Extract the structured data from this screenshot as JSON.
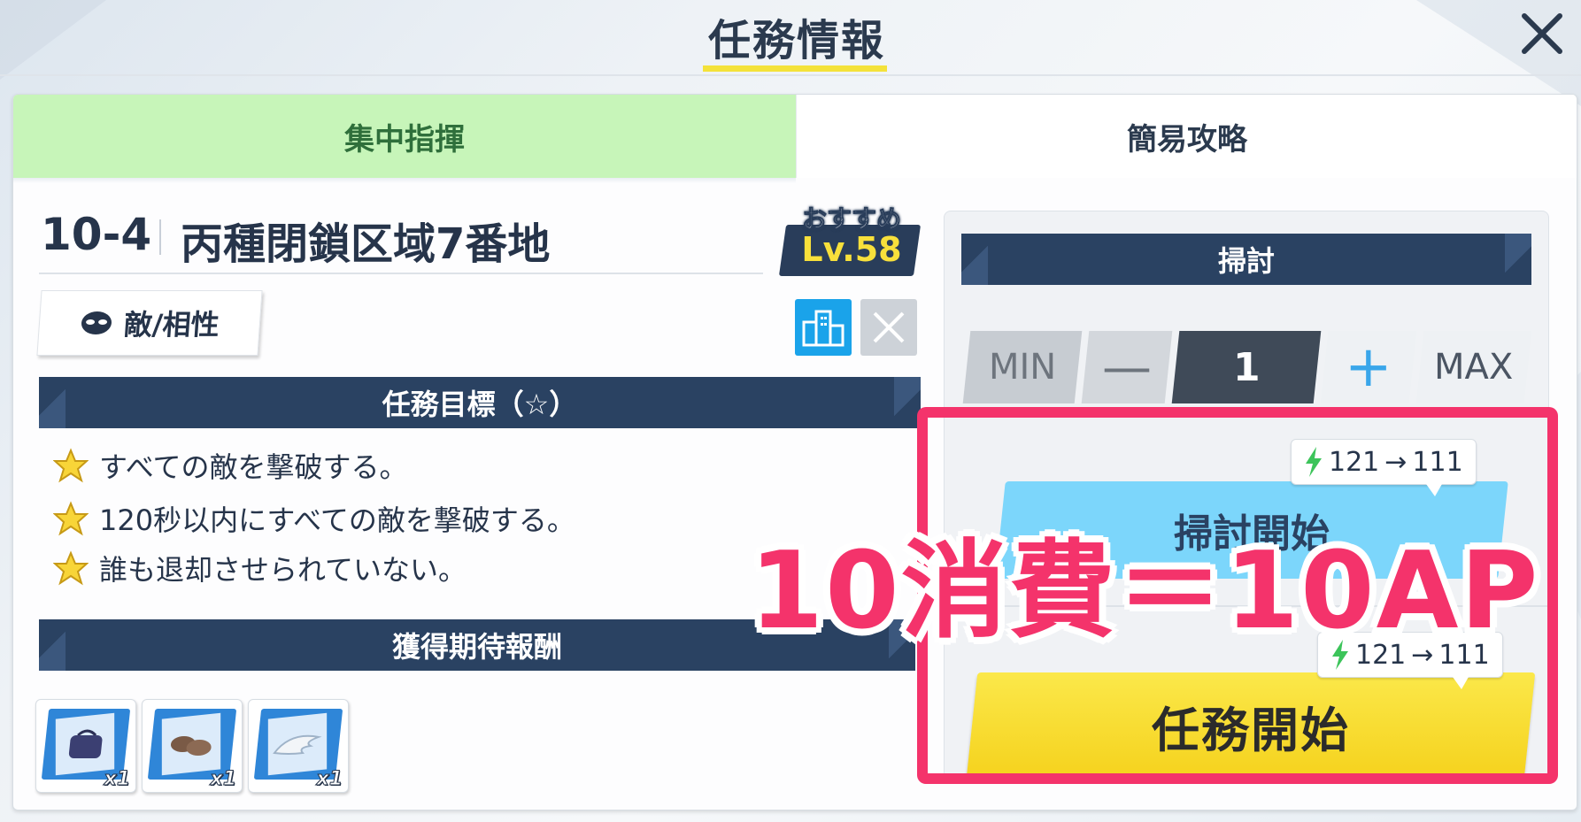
{
  "header": {
    "title": "任務情報",
    "close_icon": "close-icon"
  },
  "tabs": [
    {
      "label": "集中指揮",
      "selected": true
    },
    {
      "label": "簡易攻略",
      "selected": false
    }
  ],
  "stage": {
    "code": "10-4",
    "name": "丙種閉鎖区域7番地",
    "recommended_label": "おすすめ",
    "recommended_level": "Lv.58"
  },
  "enemy_button": {
    "label": "敵/相性",
    "icon": "enemy-mask-icon"
  },
  "terrain_icons": [
    "building-icon",
    "x-disabled-icon"
  ],
  "objectives": {
    "header": "任務目標（☆）",
    "items": [
      "すべての敵を撃破する。",
      "120秒以内にすべての敵を撃破する。",
      "誰も退却させられていない。"
    ]
  },
  "rewards": {
    "header": "獲得期待報酬",
    "items": [
      {
        "icon": "bag-icon",
        "qty": "x1"
      },
      {
        "icon": "shoes-icon",
        "qty": "x1"
      },
      {
        "icon": "wing-icon",
        "qty": "x1"
      }
    ]
  },
  "sweep": {
    "header": "掃討",
    "min_label": "MIN",
    "minus_label": "—",
    "count": "1",
    "plus_label": "+",
    "max_label": "MAX",
    "cost_from": "121",
    "cost_arrow": "→",
    "cost_to": "111",
    "button_label": "掃討開始"
  },
  "start": {
    "cost_from": "121",
    "cost_arrow": "→",
    "cost_to": "111",
    "button_label": "任務開始"
  },
  "annotation": {
    "text": "10消費＝10AP",
    "color": "#f4336b"
  },
  "colors": {
    "accent_green": "#c7f5b9",
    "navy": "#2a4262",
    "start_yellow": "#f5d21d",
    "sweep_blue": "#7cd6fb"
  }
}
